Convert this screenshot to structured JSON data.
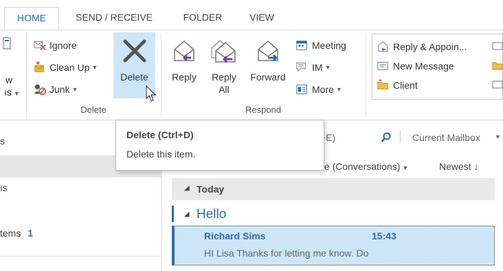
{
  "tabs": [
    {
      "label": "HOME",
      "active": true
    },
    {
      "label": "SEND / RECEIVE",
      "active": false
    },
    {
      "label": "FOLDER",
      "active": false
    },
    {
      "label": "VIEW",
      "active": false
    }
  ],
  "ribbon": {
    "left_cut": {
      "line1": "w",
      "line2": "ıs"
    },
    "delete_group": {
      "ignore": "Ignore",
      "cleanup": "Clean Up",
      "junk": "Junk",
      "delete": "Delete",
      "label": "Delete"
    },
    "respond_group": {
      "reply": "Reply",
      "reply_all_1": "Reply",
      "reply_all_2": "All",
      "forward": "Forward",
      "meeting": "Meeting",
      "im": "IM",
      "more": "More",
      "label": "Respond"
    },
    "quick_steps": {
      "reply_appoint": "Reply & Appoin...",
      "new_message": "New Message",
      "client": "Client"
    }
  },
  "tooltip": {
    "title": "Delete (Ctrl+D)",
    "desc": "Delete this item."
  },
  "left_pane": {
    "row1": "s",
    "row2": "ıs",
    "row3": "tems",
    "row3_count": "1"
  },
  "search": {
    "partial": "+E)",
    "scope": "Current Mailbox"
  },
  "sort": {
    "by": "te (Conversations)",
    "order": "Newest"
  },
  "groups": {
    "today": "Today"
  },
  "conversation": {
    "subject": "Hello"
  },
  "message": {
    "sender": "Richard Sims",
    "time": "15:43",
    "preview": "HI Lisa  Thanks for letting me know. Do"
  },
  "colors": {
    "accent": "#2b6cb0",
    "selection": "#cde6f7"
  }
}
